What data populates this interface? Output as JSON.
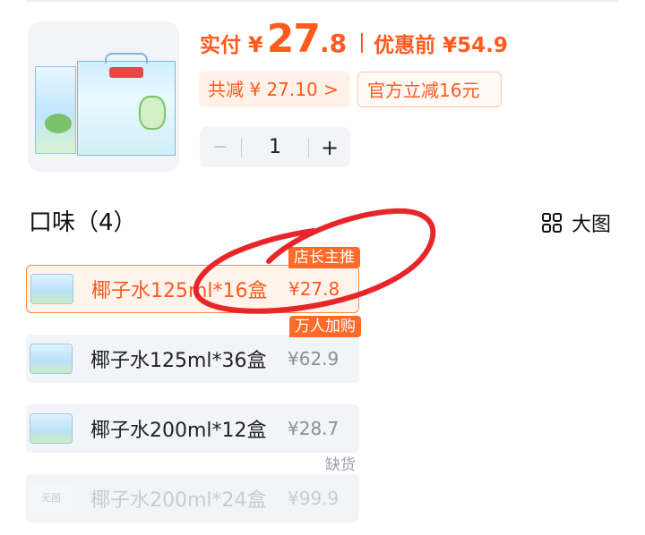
{
  "product": {
    "price_label": "实付",
    "currency": "¥",
    "price_int": "27",
    "price_dec": ".8",
    "orig_label": "优惠前 ¥54.9",
    "discount_total": "共减 ¥ 27.10 >",
    "official_discount": "官方立减16元",
    "quantity": "1",
    "minus": "−",
    "plus": "+"
  },
  "section": {
    "title": "口味（4）",
    "view_label": "大图"
  },
  "options": [
    {
      "name": "椰子水125ml*16盒",
      "price": "¥27.8",
      "tag": "店长主推",
      "state": "selected"
    },
    {
      "name": "椰子水125ml*36盒",
      "price": "¥62.9",
      "tag": "万人加购",
      "state": "normal"
    },
    {
      "name": "椰子水200ml*12盒",
      "price": "¥28.7",
      "tag": "",
      "state": "normal"
    },
    {
      "name": "椰子水200ml*24盒",
      "price": "¥99.9",
      "tag": "缺货",
      "state": "disabled",
      "thumb_text": "无图"
    }
  ],
  "colors": {
    "accent": "#ff5a1f",
    "annotation": "#e8262a"
  }
}
